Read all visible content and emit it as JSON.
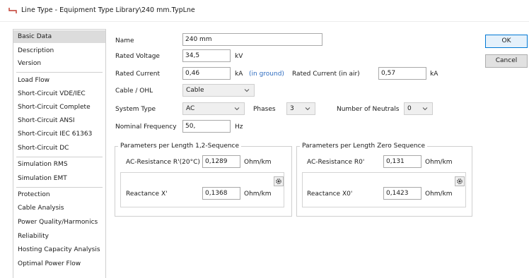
{
  "window": {
    "title": "Line Type - Equipment Type Library\\240 mm.TypLne"
  },
  "sidebar": {
    "items": [
      "Basic Data",
      "Description",
      "Version",
      "Load Flow",
      "Short-Circuit VDE/IEC",
      "Short-Circuit Complete",
      "Short-Circuit ANSI",
      "Short-Circuit IEC 61363",
      "Short-Circuit DC",
      "Simulation RMS",
      "Simulation EMT",
      "Protection",
      "Cable Analysis",
      "Power Quality/Harmonics",
      "Reliability",
      "Hosting Capacity Analysis",
      "Optimal Power Flow"
    ],
    "selected": "Basic Data"
  },
  "form": {
    "name_label": "Name",
    "name_value": "240 mm",
    "rated_voltage_label": "Rated Voltage",
    "rated_voltage_value": "34,5",
    "rated_voltage_unit": "kV",
    "rated_current_label": "Rated Current",
    "rated_current_value": "0,46",
    "rated_current_unit": "kA",
    "in_ground": "(in ground)",
    "rated_current_air_label": "Rated Current (in air)",
    "rated_current_air_value": "0,57",
    "rated_current_air_unit": "kA",
    "cable_ohl_label": "Cable / OHL",
    "cable_ohl_value": "Cable",
    "system_type_label": "System Type",
    "system_type_value": "AC",
    "phases_label": "Phases",
    "phases_value": "3",
    "neutrals_label": "Number of Neutrals",
    "neutrals_value": "0",
    "nominal_frequency_label": "Nominal Frequency",
    "nominal_frequency_value": "50,",
    "nominal_frequency_unit": "Hz"
  },
  "seq12": {
    "title": "Parameters per Length 1,2-Sequence",
    "resistance_label": "AC-Resistance R'(20°C)",
    "resistance_value": "0,1289",
    "resistance_unit": "Ohm/km",
    "reactance_label": "Reactance X'",
    "reactance_value": "0,1368",
    "reactance_unit": "Ohm/km"
  },
  "seq0": {
    "title": "Parameters per Length Zero Sequence",
    "resistance_label": "AC-Resistance R0'",
    "resistance_value": "0,131",
    "resistance_unit": "Ohm/km",
    "reactance_label": "Reactance X0'",
    "reactance_value": "0,1423",
    "reactance_unit": "Ohm/km"
  },
  "buttons": {
    "ok": "OK",
    "cancel": "Cancel"
  },
  "colors": {
    "accent": "#0078d4",
    "link_blue": "#2d6cc0",
    "selected_bg": "#dcdcdc"
  }
}
